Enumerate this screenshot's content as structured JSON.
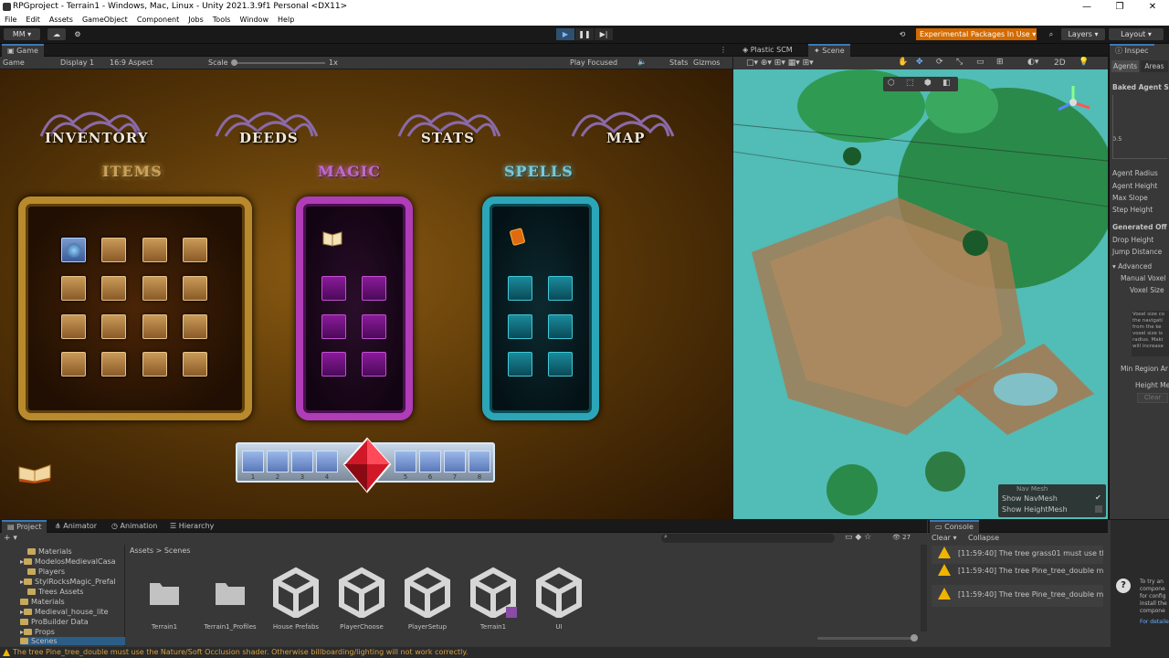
{
  "window": {
    "title": "RPGproject - Terrain1 - Windows, Mac, Linux - Unity 2021.3.9f1 Personal <DX11>",
    "controls": [
      "—",
      "❐",
      "✕"
    ]
  },
  "menu": [
    "File",
    "Edit",
    "Assets",
    "GameObject",
    "Component",
    "Jobs",
    "Tools",
    "Window",
    "Help"
  ],
  "toolbar": {
    "account": "MM",
    "experimental": "Experimental Packages In Use ▾",
    "layers": "Layers",
    "layout": "Layout"
  },
  "game_panel": {
    "tab": "Game",
    "mode": "Game",
    "display": "Display 1",
    "aspect": "16:9 Aspect",
    "scale_label": "Scale",
    "scale_value": "1x",
    "play_focused": "Play Focused",
    "stats": "Stats",
    "gizmos": "Gizmos"
  },
  "game_ui": {
    "nav": [
      "INVENTORY",
      "DEEDS",
      "STATS",
      "MAP"
    ],
    "sections": [
      "ITEMS",
      "MAGIC",
      "SPELLS"
    ],
    "hotbar_numbers": [
      "1",
      "2",
      "3",
      "4",
      "5",
      "6",
      "7",
      "8"
    ]
  },
  "scene_panel": {
    "tabs": [
      "Plastic SCM",
      "Scene"
    ],
    "mode_2d": "2D",
    "overlay_title": "Nav Mesh",
    "overlay_items": [
      "Show NavMesh",
      "Show HeightMesh"
    ]
  },
  "inspector": {
    "tab": "Inspec",
    "subtabs": [
      "Agents",
      "Areas"
    ],
    "rows": [
      "Baked Agent Si",
      "0.5",
      "Agent Radius",
      "Agent Height",
      "Max Slope",
      "Step Height",
      "Generated Off M",
      "Drop Height",
      "Jump Distance",
      "▾ Advanced",
      "Manual Voxel",
      "Voxel Size",
      "Voxel size co the navigati from the ke voxel size is radius. Maki will increase",
      "Min Region Ar",
      "Height Mesh",
      "Clear"
    ]
  },
  "bottom_tabs": [
    "Project",
    "Animator",
    "Animation",
    "Hierarchy"
  ],
  "project": {
    "tree": [
      "Materials",
      "ModelosMedievalCasa",
      "Players",
      "StylRocksMagic_Prefal",
      "Trees Assets",
      "Materials",
      "Medieval_house_lite",
      "ProBuilder Data",
      "Props",
      "Scenes"
    ],
    "breadcrumb": [
      "Assets",
      ">",
      "Scenes"
    ],
    "count": "27",
    "assets": [
      "Terrain1",
      "Terrain1_Profiles",
      "House Prefabs",
      "PlayerChoose",
      "PlayerSetup",
      "Terrain1",
      "UI"
    ]
  },
  "console": {
    "tab": "Console",
    "clear": "Clear ▾",
    "collapse": "Collapse",
    "messages": [
      "[11:59:40] The tree grass01 must use the N",
      "[11:59:40] The tree Pine_tree_double must",
      "[11:59:40] The tree Pine_tree_double must"
    ],
    "side_note": "To try an compone for config install the compone",
    "side_link": "For detaile"
  },
  "status": "The tree Pine_tree_double must use the Nature/Soft Occlusion shader. Otherwise billboarding/lighting will not work correctly.",
  "colors": {
    "accent": "#3a79bb",
    "warning": "#f0b400",
    "experimental": "#d36b00"
  }
}
